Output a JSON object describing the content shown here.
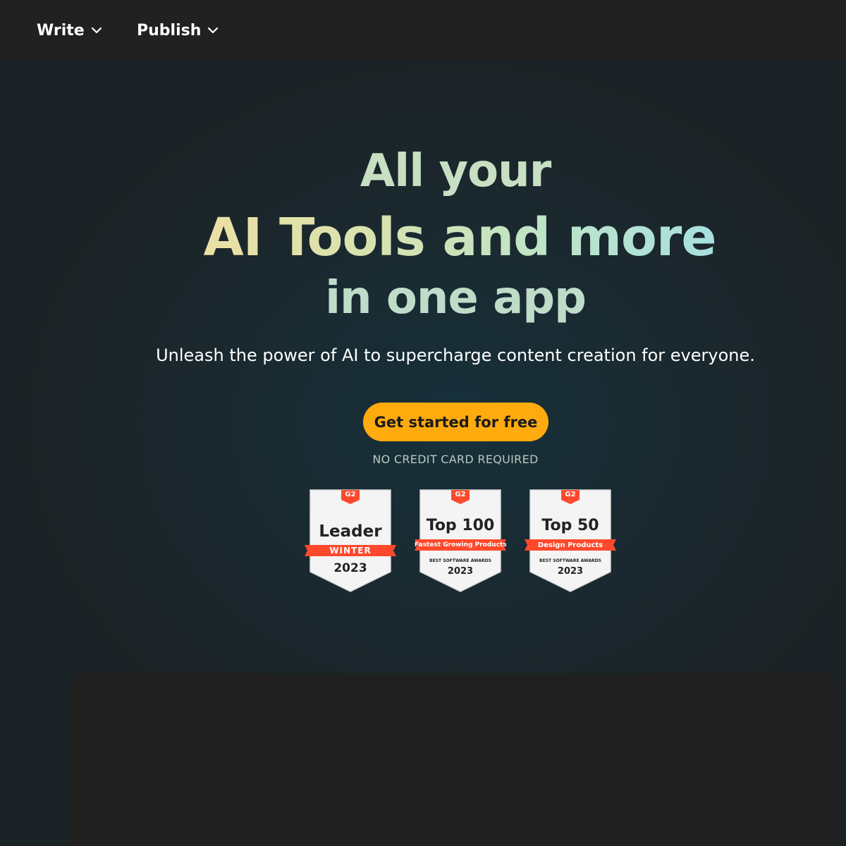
{
  "nav": {
    "items": [
      {
        "label": "Write"
      },
      {
        "label": "Publish"
      }
    ]
  },
  "hero": {
    "line1": "All your",
    "line2": "AI Tools and more",
    "line3": "in one app",
    "subtitle": "Unleash the power of AI to supercharge content creation for everyone.",
    "cta_label": "Get started for free",
    "note": "NO CREDIT CARD REQUIRED"
  },
  "badges": [
    {
      "brand": "G2",
      "title": "Leader",
      "ribbon": "WINTER",
      "small": "",
      "year": "2023"
    },
    {
      "brand": "G2",
      "title": "Top 100",
      "ribbon": "Fastest Growing Products",
      "small": "BEST SOFTWARE AWARDS",
      "year": "2023"
    },
    {
      "brand": "G2",
      "title": "Top 50",
      "ribbon": "Design Products",
      "small": "BEST SOFTWARE AWARDS",
      "year": "2023"
    }
  ],
  "colors": {
    "accent": "#ffab0e",
    "g2_red": "#ff492c",
    "nav_bg": "#212121",
    "panel_bg": "#202020"
  }
}
